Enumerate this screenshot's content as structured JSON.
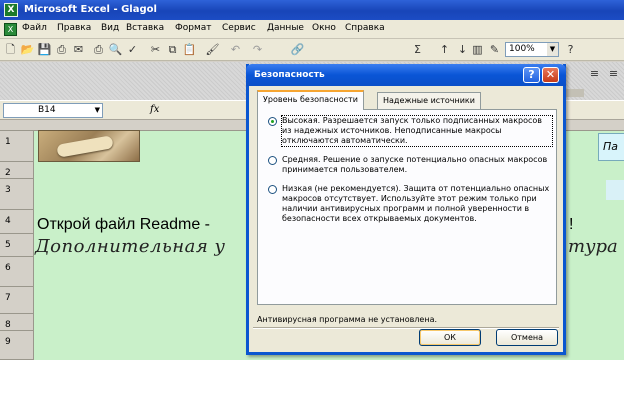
{
  "window": {
    "title": "Microsoft Excel - Glagol",
    "app_icon": "X"
  },
  "menu": {
    "doc_icon": "X",
    "items": [
      "Файл",
      "Правка",
      "Вид",
      "Вставка",
      "Формат",
      "Сервис",
      "Данные",
      "Окно",
      "Справка"
    ]
  },
  "toolbar": {
    "sigma": "Σ",
    "zoom": "100%",
    "help": "?"
  },
  "formula_bar": {
    "cell_ref": "B14",
    "fx": "fx"
  },
  "rows": [
    "1",
    "2",
    "3",
    "4",
    "5",
    "6",
    "7",
    "8",
    "9"
  ],
  "sheet": {
    "cell_pa": "Па",
    "row4_left": "Открой файл Readme -",
    "row4_right": "!",
    "row5_left": "Дополнительная у",
    "row5_right": "тура"
  },
  "dialog": {
    "title": "Безопасность",
    "tabs": [
      "Уровень безопасности",
      "Надежные источники"
    ],
    "options": [
      {
        "text": "Высокая. Разрешается запуск только подписанных макросов из надежных источников. Неподписанные макросы отключаются автоматически.",
        "selected": true
      },
      {
        "text": "Средняя. Решение о запуске потенциально опасных макросов принимается пользователем.",
        "selected": false
      },
      {
        "text": "Низкая (не рекомендуется). Защита от потенциально опасных макросов отсутствует. Используйте этот режим только при наличии антивирусных программ и полной уверенности в безопасности всех открываемых документов.",
        "selected": false
      }
    ],
    "status": "Антивирусная программа не установлена.",
    "ok": "ОК",
    "cancel": "Отмена"
  },
  "colors": {
    "accent": "#0a55d6",
    "sheet_bg": "#c9f0c9",
    "titlebar": "#1845b8"
  }
}
